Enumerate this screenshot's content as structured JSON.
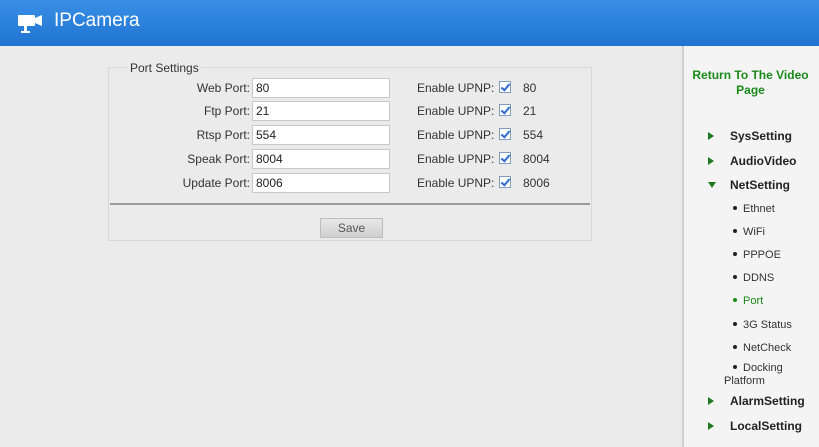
{
  "header": {
    "title": "IPCamera",
    "logo_icon": "camera-icon",
    "background": "#1e74d0"
  },
  "port_settings": {
    "legend": "Port Settings",
    "rows": [
      {
        "label": "Web Port:",
        "value": "80",
        "upnp_label": "Enable UPNP:",
        "upnp_checked": true,
        "upnp_port": "80"
      },
      {
        "label": "Ftp Port:",
        "value": "21",
        "upnp_label": "Enable UPNP:",
        "upnp_checked": true,
        "upnp_port": "21"
      },
      {
        "label": "Rtsp Port:",
        "value": "554",
        "upnp_label": "Enable UPNP:",
        "upnp_checked": true,
        "upnp_port": "554"
      },
      {
        "label": "Speak Port:",
        "value": "8004",
        "upnp_label": "Enable UPNP:",
        "upnp_checked": true,
        "upnp_port": "8004"
      },
      {
        "label": "Update Port:",
        "value": "8006",
        "upnp_label": "Enable UPNP:",
        "upnp_checked": true,
        "upnp_port": "8006"
      }
    ],
    "save_label": "Save"
  },
  "sidebar": {
    "return_link": "Return To The Video Page",
    "accent": "#1a8a1a",
    "sys_setting": "SysSetting",
    "audio_video": "AudioVideo",
    "net_setting": "NetSetting",
    "net_items": [
      "Ethnet",
      "WiFi",
      "PPPOE",
      "DDNS",
      "Port",
      "3G Status",
      "NetCheck",
      "Docking Platform"
    ],
    "active_item": "Port",
    "alarm_setting": "AlarmSetting",
    "local_setting": "LocalSetting"
  }
}
